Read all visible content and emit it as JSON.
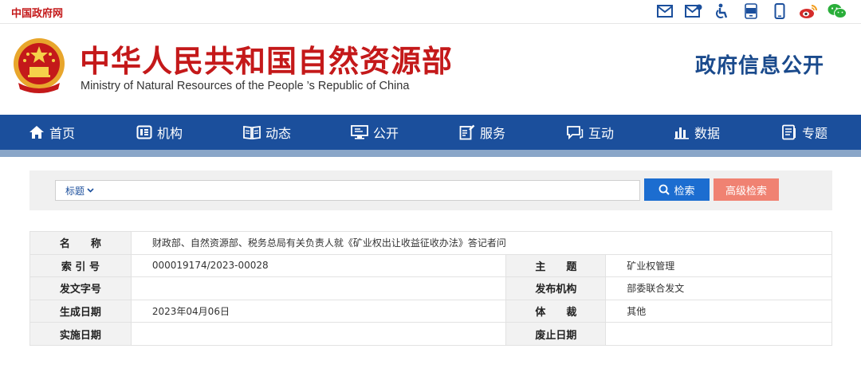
{
  "topbar": {
    "site_name": "中国政府网",
    "icons": [
      "mail-icon",
      "mail-alt-icon",
      "accessibility-icon",
      "app-icon",
      "mobile-icon",
      "weibo-icon",
      "wechat-icon"
    ]
  },
  "header": {
    "title_cn": "中华人民共和国自然资源部",
    "title_en": "Ministry of Natural Resources of the People ’s Republic of China",
    "section_title": "政府信息公开"
  },
  "nav": {
    "items": [
      {
        "label": "首页",
        "icon": "home-icon"
      },
      {
        "label": "机构",
        "icon": "org-icon"
      },
      {
        "label": "动态",
        "icon": "book-icon"
      },
      {
        "label": "公开",
        "icon": "monitor-icon"
      },
      {
        "label": "服务",
        "icon": "edit-doc-icon"
      },
      {
        "label": "互动",
        "icon": "chat-icon"
      },
      {
        "label": "数据",
        "icon": "bar-chart-icon"
      },
      {
        "label": "专题",
        "icon": "doc-list-icon"
      }
    ]
  },
  "search": {
    "field_select": "标题",
    "query_value": "",
    "search_button": "检索",
    "advanced_button": "高级检索"
  },
  "info": {
    "name_label": "名　　称",
    "name_value": "财政部、自然资源部、税务总局有关负责人就《矿业权出让收益征收办法》答记者问",
    "index_label": "索 引 号",
    "index_value": "000019174/2023-00028",
    "topic_label": "主　　题",
    "topic_value": "矿业权管理",
    "docno_label": "发文字号",
    "docno_value": "",
    "publisher_label": "发布机构",
    "publisher_value": "部委联合发文",
    "date_label": "生成日期",
    "date_value": "2023年04月06日",
    "genre_label": "体　　裁",
    "genre_value": "其他",
    "effective_label": "实施日期",
    "effective_value": "",
    "expire_label": "废止日期",
    "expire_value": ""
  },
  "colors": {
    "brand_red": "#c4191a",
    "nav_blue": "#1b4f9c",
    "search_blue": "#1c6dd0",
    "advanced_salmon": "#f08272"
  }
}
